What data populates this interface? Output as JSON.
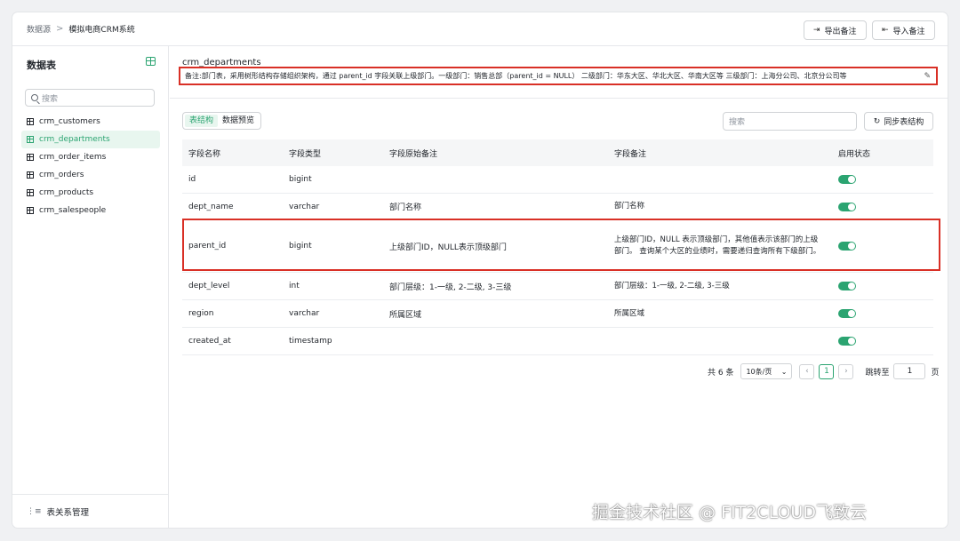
{
  "breadcrumb": {
    "root": "数据源",
    "sep": ">",
    "current": "模拟电商CRM系统"
  },
  "header": {
    "export_label": "导出备注",
    "import_label": "导入备注"
  },
  "sidebar": {
    "title": "数据表",
    "search_placeholder": "搜索",
    "items": [
      {
        "label": "crm_customers",
        "active": false
      },
      {
        "label": "crm_departments",
        "active": true
      },
      {
        "label": "crm_order_items",
        "active": false
      },
      {
        "label": "crm_orders",
        "active": false
      },
      {
        "label": "crm_products",
        "active": false
      },
      {
        "label": "crm_salespeople",
        "active": false
      }
    ],
    "footer_label": "表关系管理"
  },
  "main": {
    "table_name": "crm_departments",
    "remark": "备注:部门表，采用树形结构存储组织架构，通过 parent_id 字段关联上级部门。一级部门：销售总部（parent_id = NULL） 二级部门：华东大区、华北大区、华南大区等 三级部门：上海分公司、北京分公司等",
    "tabs": [
      {
        "label": "表结构",
        "active": true
      },
      {
        "label": "数据预览",
        "active": false
      }
    ],
    "search_placeholder": "搜索",
    "sync_label": "同步表结构",
    "columns": [
      "字段名称",
      "字段类型",
      "字段原始备注",
      "字段备注",
      "启用状态"
    ],
    "rows": [
      {
        "name": "id",
        "type": "bigint",
        "orig": "",
        "note": "",
        "enabled": true
      },
      {
        "name": "dept_name",
        "type": "varchar",
        "orig": "部门名称",
        "note": "部门名称",
        "enabled": true
      },
      {
        "name": "parent_id",
        "type": "bigint",
        "orig": "上级部门ID，NULL表示顶级部门",
        "note": "上级部门ID，NULL 表示顶级部门，其他值表示该部门的上级部门。 查询某个大区的业绩时，需要递归查询所有下级部门。",
        "enabled": true
      },
      {
        "name": "dept_level",
        "type": "int",
        "orig": "部门层级：1-一级, 2-二级, 3-三级",
        "note": "部门层级：1-一级, 2-二级, 3-三级",
        "enabled": true
      },
      {
        "name": "region",
        "type": "varchar",
        "orig": "所属区域",
        "note": "所属区域",
        "enabled": true
      },
      {
        "name": "created_at",
        "type": "timestamp",
        "orig": "",
        "note": "",
        "enabled": true
      }
    ],
    "pager": {
      "total": "共 6 条",
      "page_size": "10条/页",
      "current_page": "1",
      "jump_label": "跳转至",
      "jump_value": "1",
      "page_unit": "页"
    }
  },
  "watermark": "掘金技术社区 @ FIT2CLOUD飞致云",
  "colors": {
    "accent": "#2ba471",
    "highlight": "#d93026"
  }
}
